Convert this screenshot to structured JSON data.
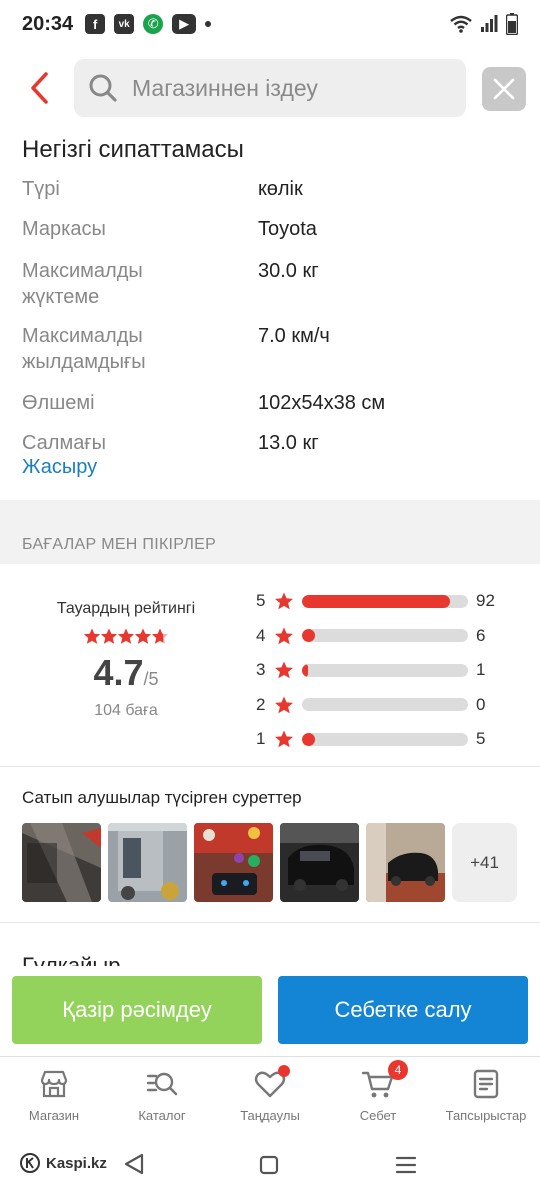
{
  "status_bar": {
    "time": "20:34"
  },
  "search": {
    "placeholder": "Магазиннен іздеу"
  },
  "specs": {
    "title": "Негізгі сипаттамасы",
    "rows": [
      {
        "key": "Түрі",
        "value": "көлік"
      },
      {
        "key": "Маркасы",
        "value": "Toyota"
      },
      {
        "key": "Максималды жүктеме",
        "value": "30.0 кг"
      },
      {
        "key": "Максималды жылдамдығы",
        "value": "7.0 км/ч"
      },
      {
        "key": "Өлшемі",
        "value": "102x54x38 см"
      },
      {
        "key": "Салмағы",
        "value": "13.0 кг"
      }
    ],
    "hide_link": "Жасыру"
  },
  "reviews": {
    "section_caption": "БАҒАЛАР МЕН ПІКІРЛЕР",
    "rating_label": "Тауардың рейтингі",
    "rating_value": "4.7",
    "rating_of": "/5",
    "rating_count": "104 баға",
    "distribution": [
      {
        "stars": "5",
        "count": "92",
        "fraction": 0.89
      },
      {
        "stars": "4",
        "count": "6",
        "fraction": 0.06
      },
      {
        "stars": "3",
        "count": "1",
        "fraction": 0.01
      },
      {
        "stars": "2",
        "count": "0",
        "fraction": 0.0
      },
      {
        "stars": "1",
        "count": "5",
        "fraction": 0.06
      }
    ]
  },
  "photos": {
    "title": "Сатып алушылар түсірген суреттер",
    "more": "+41"
  },
  "review_peek": "Гүлкайыр",
  "actions": {
    "order_label": "Қазір рәсімдеу",
    "cart_label": "Себетке салу"
  },
  "colors": {
    "accent_red": "#e7372f",
    "order_green": "#93d35b",
    "cart_blue": "#1484d5",
    "link_blue": "#1a7fbf"
  },
  "tabbar": {
    "items": [
      {
        "label": "Магазин",
        "icon": "shop-icon"
      },
      {
        "label": "Каталог",
        "icon": "catalog-search-icon"
      },
      {
        "label": "Таңдаулы",
        "icon": "heart-icon"
      },
      {
        "label": "Себет",
        "icon": "cart-icon",
        "badge": "4"
      },
      {
        "label": "Тапсырыстар",
        "icon": "orders-icon"
      }
    ]
  },
  "system_nav": {
    "brand": "Kaspi.kz"
  }
}
